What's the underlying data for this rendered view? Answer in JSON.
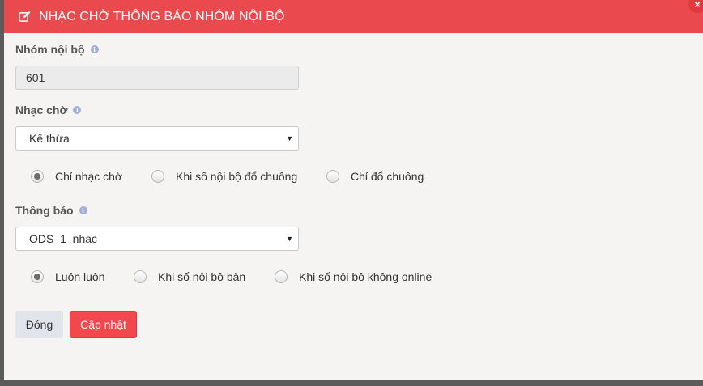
{
  "header": {
    "title": "NHẠC CHỜ THÔNG BÁO NHÓM NỘI BỘ",
    "icon": "edit-icon",
    "close": "×"
  },
  "group": {
    "label": "Nhóm nội bộ",
    "info": "i",
    "value": "601"
  },
  "hold_music": {
    "label": "Nhạc chờ",
    "info": "i",
    "selected": "Kế thừa",
    "options": [
      {
        "label": "Chỉ nhạc chờ",
        "checked": true
      },
      {
        "label": "Khi số nội bộ đổ chuông",
        "checked": false
      },
      {
        "label": "Chỉ đổ chuông",
        "checked": false
      }
    ]
  },
  "announcement": {
    "label": "Thông báo",
    "info": "i",
    "selected": "ODS  1  nhac",
    "options": [
      {
        "label": "Luôn luôn",
        "checked": true
      },
      {
        "label": "Khi số nội bộ bận",
        "checked": false
      },
      {
        "label": "Khi số nội bộ không online",
        "checked": false
      }
    ]
  },
  "buttons": {
    "close": "Đóng",
    "update": "Cập nhật"
  }
}
